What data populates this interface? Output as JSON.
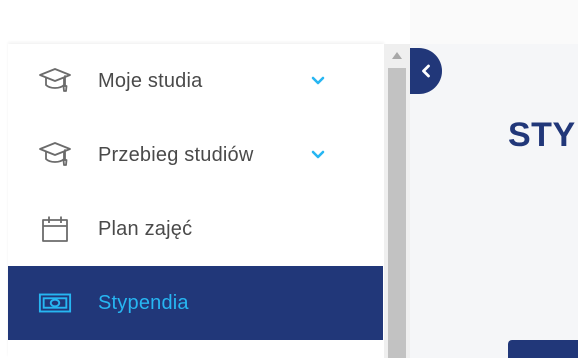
{
  "sidebar": {
    "items": [
      {
        "label": "Moje studia",
        "icon": "graduation-cap-icon",
        "expandable": true
      },
      {
        "label": "Przebieg studiów",
        "icon": "graduation-cap-icon",
        "expandable": true
      },
      {
        "label": "Plan zajęć",
        "icon": "calendar-icon",
        "expandable": false
      },
      {
        "label": "Stypendia",
        "icon": "money-icon",
        "expandable": false,
        "active": true
      }
    ]
  },
  "main": {
    "title": "STY"
  },
  "colors": {
    "primary": "#213779",
    "accent": "#27b6f2",
    "text": "#4a4a4a",
    "icon_gray": "#6b6b6b"
  }
}
